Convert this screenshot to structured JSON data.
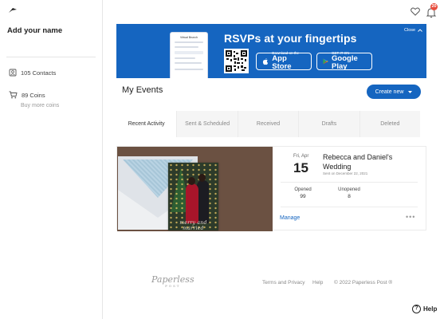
{
  "sidebar": {
    "user_name": "Add your name",
    "contacts_label": "105 Contacts",
    "coins_label": "89 Coins",
    "buy_more_label": "Buy more coins"
  },
  "header": {
    "notification_count": "20",
    "icons": [
      "heart-icon",
      "bell-icon"
    ]
  },
  "banner": {
    "title": "RSVPs at your fingertips",
    "close_label": "Close",
    "phone_preview_title": "Virtual Brunch",
    "app_store_small": "Download on the",
    "app_store_big": "App Store",
    "google_play_small": "GET IT ON",
    "google_play_big": "Google Play",
    "background_color": "#1565c0"
  },
  "main": {
    "title": "My Events",
    "create_new_label": "Create new",
    "tabs": [
      {
        "label": "Recent Activity",
        "active": true
      },
      {
        "label": "Sent & Scheduled",
        "active": false
      },
      {
        "label": "Received",
        "active": false
      },
      {
        "label": "Drafts",
        "active": false
      },
      {
        "label": "Deleted",
        "active": false
      }
    ]
  },
  "event": {
    "day_label": "Fri, Apr",
    "day_number": "15",
    "title": "Rebecca and Daniel's Wedding",
    "sent_on": "Sent on December 22, 2021",
    "card_text": "merry and married",
    "opened_label": "Opened",
    "opened_value": "99",
    "unopened_label": "Unopened",
    "unopened_value": "8",
    "manage_label": "Manage",
    "more_label": "•••"
  },
  "footer": {
    "logo_text": "Paperless",
    "logo_sub": "POST",
    "terms_label": "Terms and Privacy",
    "help_link_label": "Help",
    "copyright": "© 2022 Paperless Post ®"
  },
  "help_button": {
    "label": "Help",
    "icon_glyph": "?"
  }
}
